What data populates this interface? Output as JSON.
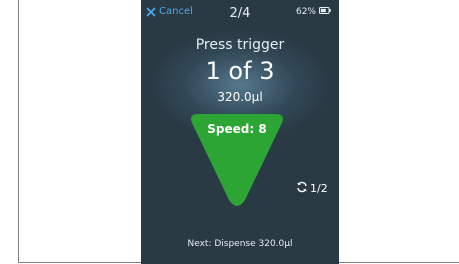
{
  "topbar": {
    "cancel_label": "Cancel",
    "step": "2/4",
    "battery_percent": "62%"
  },
  "main": {
    "prompt": "Press trigger",
    "count": "1 of 3",
    "volume": "320.0µl"
  },
  "trigger": {
    "speed_label": "Speed: 8",
    "color": "#2ca534"
  },
  "cycle": {
    "label": "1/2",
    "icon": "refresh-icon"
  },
  "footer": {
    "next": "Next: Dispense 320.0µl"
  },
  "colors": {
    "screen_bg": "#2a3a45",
    "accent": "#4aa8e8"
  }
}
